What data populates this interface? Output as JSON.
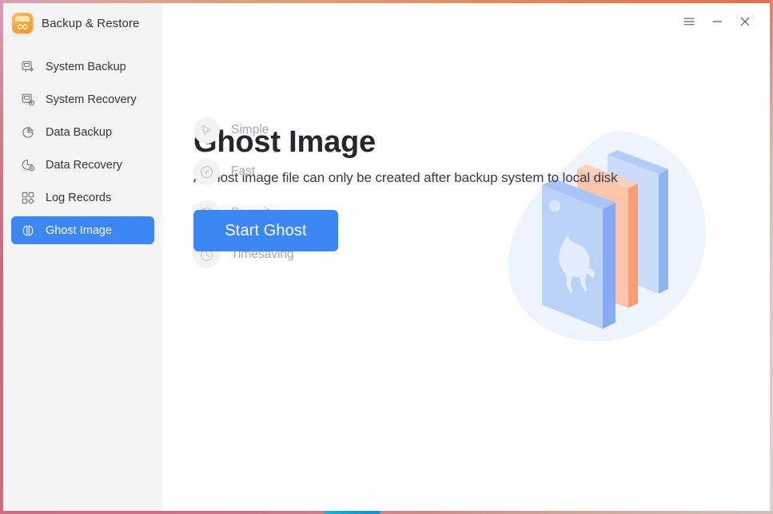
{
  "window": {
    "app_title": "Backup & Restore",
    "app_icon": "backup-app-icon",
    "controls": [
      {
        "name": "menu-button",
        "icon": "hamburger-menu-icon",
        "label": "≡"
      },
      {
        "name": "minimize-button",
        "icon": "minimize-icon",
        "label": "−"
      },
      {
        "name": "close-button",
        "icon": "close-icon",
        "label": "×"
      }
    ],
    "border_colors": {
      "top_start": "#d9a0b8",
      "top_end": "#e07055",
      "left": "#ca6781",
      "right": "#e2815e",
      "bottom": "#cd6b85",
      "bottom_accent": "#0f9fd4"
    }
  },
  "sidebar": {
    "background": "#f4f4f5",
    "active_color": "#3d87f5",
    "items": [
      {
        "label": "System Backup",
        "icon": "monitor-backup-icon",
        "active": false
      },
      {
        "label": "System Recovery",
        "icon": "monitor-recovery-icon",
        "active": false
      },
      {
        "label": "Data Backup",
        "icon": "pie-chart-backup-icon",
        "active": false
      },
      {
        "label": "Data Recovery",
        "icon": "pie-chart-recovery-icon",
        "active": false
      },
      {
        "label": "Log Records",
        "icon": "grid-squares-icon",
        "active": false
      },
      {
        "label": "Ghost Image",
        "icon": "ghost-image-panels-icon",
        "active": true
      }
    ]
  },
  "main": {
    "title": "Ghost Image",
    "subtitle": "A ghost image file can only be created after backup system to local disk",
    "features": [
      {
        "label": "Simple",
        "icon": "cursor-pointer-icon"
      },
      {
        "label": "Fast",
        "icon": "speedometer-icon"
      },
      {
        "label": "Security",
        "icon": "shield-check-icon"
      },
      {
        "label": "Timesaving",
        "icon": "clock-icon"
      }
    ],
    "cta_label": "Start Ghost",
    "cta_color": "#3d87f5",
    "illustration": {
      "name": "ghost-image-stacked-disks-illustration",
      "blob_color": "#eef3fd",
      "front_plate_color": "#b4cdf7",
      "middle_plate_color": "#f9b79a",
      "back_plate_color": "#a9c4f6",
      "edge_color": "#7fa6ef"
    }
  }
}
